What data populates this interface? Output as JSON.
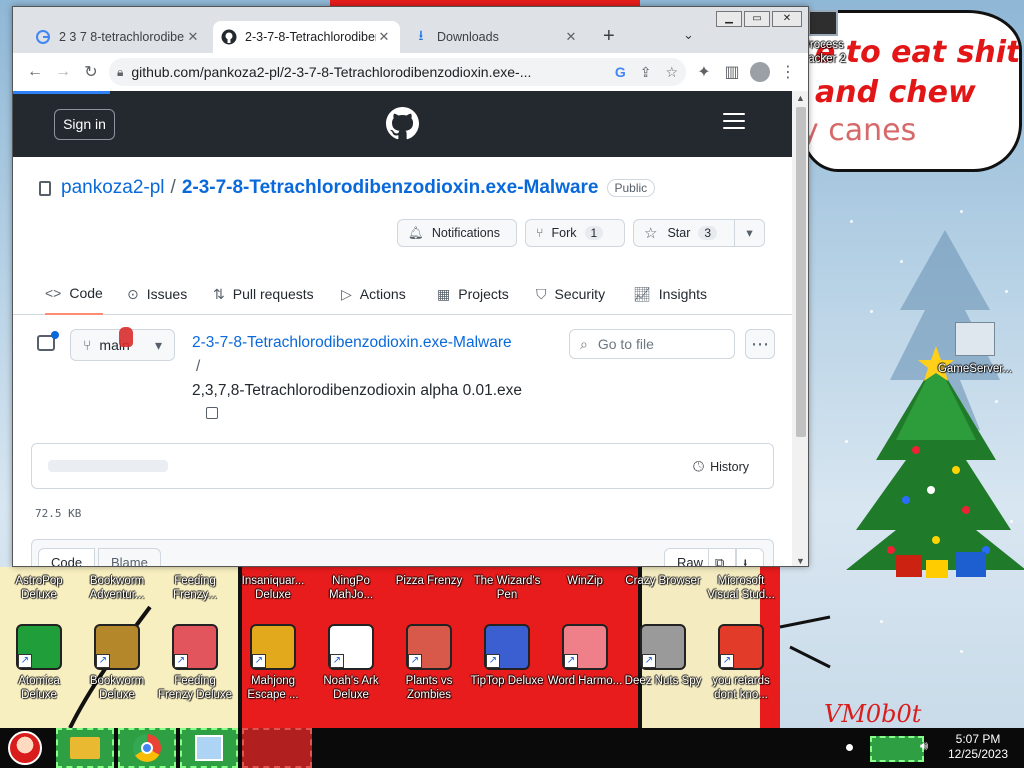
{
  "browser": {
    "tabs": [
      {
        "title": "2 3 7 8-tetrachlorodibenzodioxin",
        "icon": "google-icon"
      },
      {
        "title": "2-3-7-8-Tetrachlorodibenzodioxin",
        "icon": "github-icon"
      },
      {
        "title": "Downloads",
        "icon": "download-icon"
      }
    ],
    "new_tab": "+",
    "url": "github.com/pankoza2-pl/2-3-7-8-Tetrachlorodibenzodioxin.exe-..."
  },
  "github": {
    "signin": "Sign in",
    "owner": "pankoza2-pl",
    "separator": "/",
    "repo": "2-3-7-8-Tetrachlorodibenzodioxin.exe-Malware",
    "visibility": "Public",
    "notifications": "Notifications",
    "fork_label": "Fork",
    "fork_count": "1",
    "star_label": "Star",
    "star_count": "3",
    "nav": [
      "Code",
      "Issues",
      "Pull requests",
      "Actions",
      "Projects",
      "Security",
      "Insights"
    ],
    "branch": "main",
    "goto_file": "Go to file",
    "breadcrumb_repo": "2-3-7-8-Tetrachlorodibenzodioxin.exe-Malware",
    "breadcrumb_sep": "/",
    "filename": "2,3,7,8-Tetrachlorodibenzodioxin alpha 0.01.exe",
    "history": "History",
    "file_size": "72.5 KB",
    "code_tab": "Code",
    "blame_tab": "Blame",
    "raw": "Raw"
  },
  "desktop": {
    "speech_lines": [
      "e to eat shit",
      "and chew",
      "y canes"
    ],
    "top_icons": [
      "Process Hacker 2",
      "GameServer..."
    ],
    "row1": [
      "AstroPop Deluxe",
      "Bookworm Adventur...",
      "Feeding Frenzy...",
      "Insaniquar... Deluxe",
      "NingPo MahJo...",
      "Pizza Frenzy",
      "The Wizard's Pen",
      "WinZip",
      "Crazy Browser",
      "Microsoft Visual Stud..."
    ],
    "row2": [
      "Atomica Deluxe",
      "Bookworm Deluxe",
      "Feeding Frenzy Deluxe",
      "Mahjong Escape ...",
      "Noah's Ark Deluxe",
      "Plants vs Zombies",
      "TipTop Deluxe",
      "Word Harmo...",
      "Deez Nuts Spy",
      "you retards dont kno..."
    ],
    "watermark": "VM0b0t"
  },
  "taskbar": {
    "time": "5:07 PM",
    "date": "12/25/2023"
  },
  "colors": {
    "github_blue": "#0969da",
    "github_dark": "#24292f",
    "desktop_red": "#e81c1c",
    "speech_red": "#e21616"
  }
}
